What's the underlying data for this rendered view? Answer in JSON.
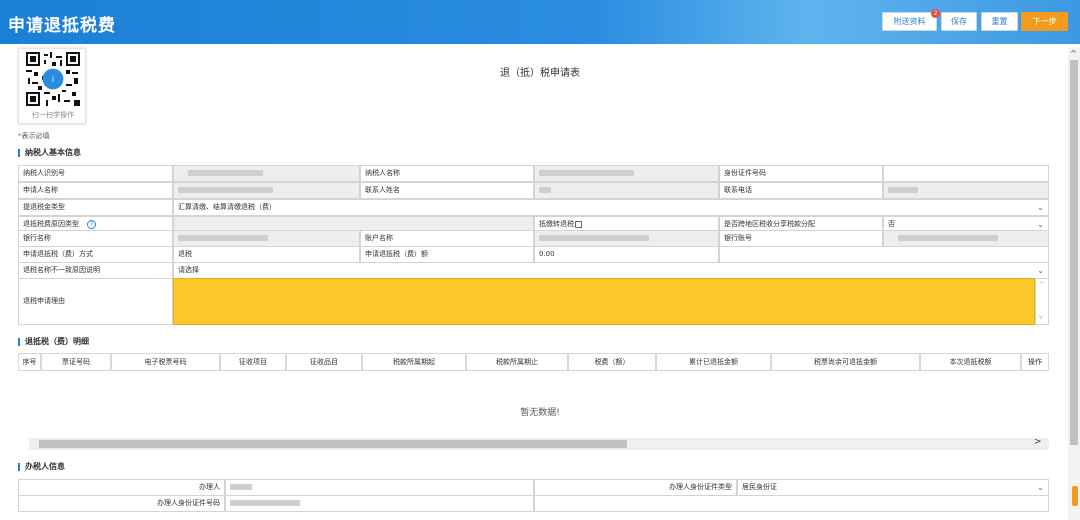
{
  "header": {
    "title": "申请退抵税费",
    "buttons": {
      "attach": "附送资料",
      "attach_badge": "2",
      "save": "保存",
      "reset": "重置",
      "next": "下一步"
    }
  },
  "qr": {
    "caption": "扫一扫学操作"
  },
  "form": {
    "title": "退（抵）税申请表",
    "required_note": "表示必填",
    "required_mark": "*"
  },
  "basic_info": {
    "section_title": "纳税人基本信息",
    "taxpayer_id_label": "纳税人识别号",
    "taxpayer_name_label": "纳税人名称",
    "id_number_label": "身份证件号码",
    "applicant_name_label": "申请人名称",
    "contact_name_label": "联系人姓名",
    "contact_phone_label": "联系电话",
    "refund_type_label": "提退税金类型",
    "refund_type_value": "汇算清缴、结算清缴退税（费）",
    "reason_type_label": "退抵税费原因类型",
    "refund_transfer_label": "抵缴转退税",
    "cross_region_label": "是否跨地区税收分享税款分配",
    "cross_region_value": "否",
    "bank_name_label": "银行名称",
    "account_name_label": "账户名称",
    "bank_account_label": "银行账号",
    "method_label": "申请退抵税（费）方式",
    "method_value": "退税",
    "amount_label": "申请退抵税（费）额",
    "amount_value": "0.00",
    "mismatch_label": "退税名称不一致原因说明",
    "mismatch_value": "请选择",
    "reason_label": "退税申请理由"
  },
  "detail": {
    "section_title": "退抵税（费）明细",
    "columns": [
      "序号",
      "票证号码",
      "电子税票号码",
      "征收项目",
      "征收品目",
      "税款所属期起",
      "税款所属期止",
      "税费（额）",
      "累计已退抵金额",
      "税票尚余可退抵金额",
      "本次退抵税额",
      "操作"
    ],
    "empty_text": "暂无数据!"
  },
  "agent_info": {
    "section_title": "办税人信息",
    "agent_label": "办理人",
    "agent_id_type_label": "办理人身份证件类型",
    "agent_id_type_value": "居民身份证",
    "agent_id_number_label": "办理人身份证件号码"
  },
  "colors": {
    "header_blue": "#1a7fd6",
    "next_orange": "#f39b1e",
    "reason_yellow": "#fcc72a"
  }
}
